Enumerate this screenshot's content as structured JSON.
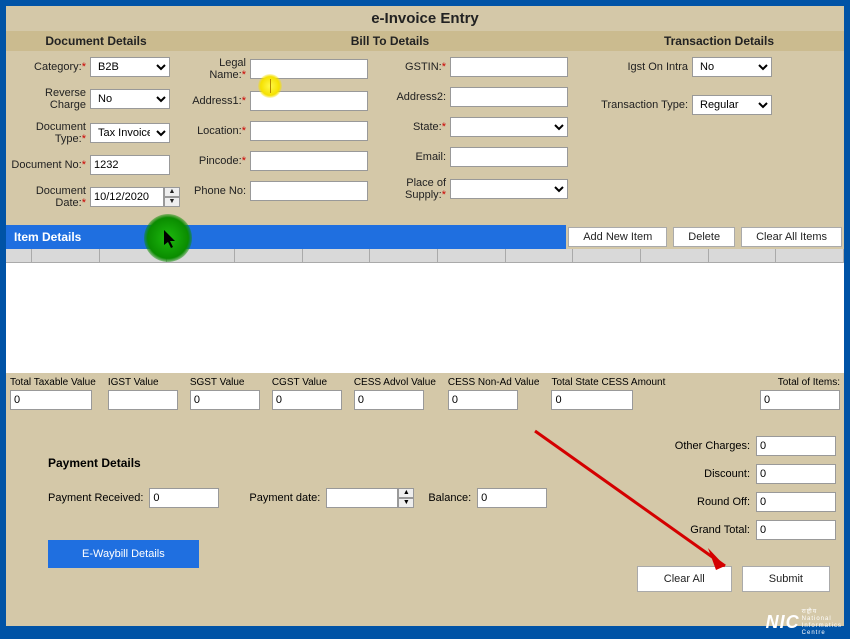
{
  "title": "e-Invoice Entry",
  "sections": {
    "document": "Document Details",
    "billto": "Bill To Details",
    "transaction": "Transaction Details"
  },
  "document": {
    "category_label": "Category:",
    "category": "B2B",
    "reverse_label": "Reverse Charge",
    "reverse": "No",
    "type_label": "Document Type:",
    "type": "Tax Invoice",
    "no_label": "Document No:",
    "no": "1232",
    "date_label": "Document Date:",
    "date": "10/12/2020"
  },
  "billto": {
    "legal_label": "Legal Name:",
    "gstin_label": "GSTIN:",
    "addr1_label": "Address1:",
    "addr2_label": "Address2:",
    "location_label": "Location:",
    "state_label": "State:",
    "pincode_label": "Pincode:",
    "email_label": "Email:",
    "phone_label": "Phone No:",
    "pos_label": "Place of Supply:"
  },
  "transaction": {
    "igst_label": "Igst On Intra",
    "igst": "No",
    "ttype_label": "Transaction Type:",
    "ttype": "Regular"
  },
  "items": {
    "header": "Item Details",
    "add": "Add New Item",
    "delete": "Delete",
    "clear": "Clear All Items"
  },
  "totals": {
    "ttv_label": "Total Taxable Value",
    "ttv": "0",
    "igst_label": "IGST Value",
    "igst": "",
    "sgst_label": "SGST Value",
    "sgst": "0",
    "cgst_label": "CGST Value",
    "cgst": "0",
    "cessadv_label": "CESS Advol Value",
    "cessadv": "0",
    "cessna_label": "CESS Non-Ad Value",
    "cessna": "0",
    "statecess_label": "Total State CESS Amount",
    "statecess": "0",
    "items_label": "Total of Items:",
    "items": "0"
  },
  "charges": {
    "other_label": "Other Charges:",
    "other": "0",
    "discount_label": "Discount:",
    "discount": "0",
    "round_label": "Round Off:",
    "round": "0",
    "grand_label": "Grand Total:",
    "grand": "0"
  },
  "payment": {
    "header": "Payment Details",
    "recv_label": "Payment Received:",
    "recv": "0",
    "date_label": "Payment date:",
    "date": "",
    "bal_label": "Balance:",
    "bal": "0",
    "ewb": "E-Waybill Details"
  },
  "footer": {
    "clear": "Clear All",
    "submit": "Submit"
  },
  "logo": "NIC"
}
